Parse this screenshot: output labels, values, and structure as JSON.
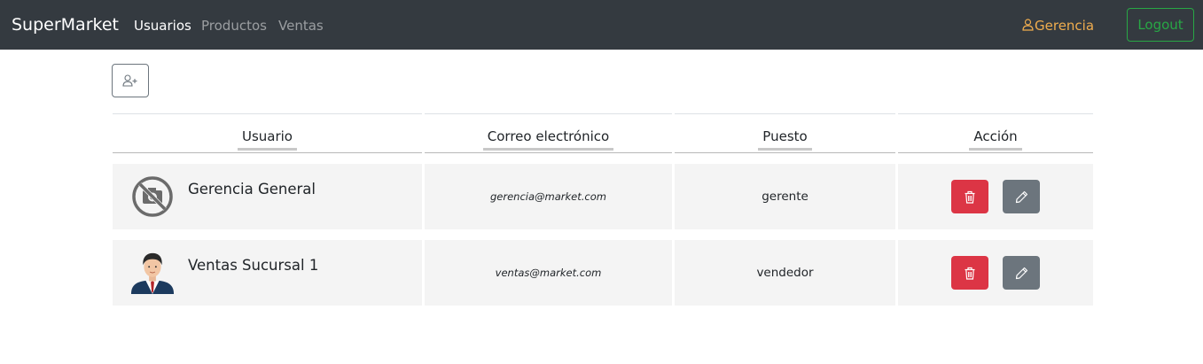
{
  "navbar": {
    "brand": "SuperMarket",
    "links": [
      "Usuarios",
      "Productos",
      "Ventas"
    ],
    "active_link": "Usuarios",
    "user_label": "Gerencia",
    "logout_label": "Logout"
  },
  "table": {
    "headers": [
      "Usuario",
      "Correo electrónico",
      "Puesto",
      "Acción"
    ],
    "rows": [
      {
        "name": "Gerencia General",
        "email": "gerencia@market.com",
        "role": "gerente",
        "avatar": "no-photo-icon"
      },
      {
        "name": "Ventas Sucursal 1",
        "email": "ventas@market.com",
        "role": "vendedor",
        "avatar": "businessman-avatar"
      }
    ]
  },
  "icons": {
    "add_user": "person-plus-icon",
    "delete": "trash-icon",
    "edit": "pencil-icon",
    "user": "person-icon"
  },
  "colors": {
    "navbar_bg": "#343a40",
    "user_link": "#f0ad4e",
    "logout": "#28a745",
    "delete": "#dc3545",
    "edit": "#6c757d",
    "row_bg": "#f4f4f4"
  }
}
